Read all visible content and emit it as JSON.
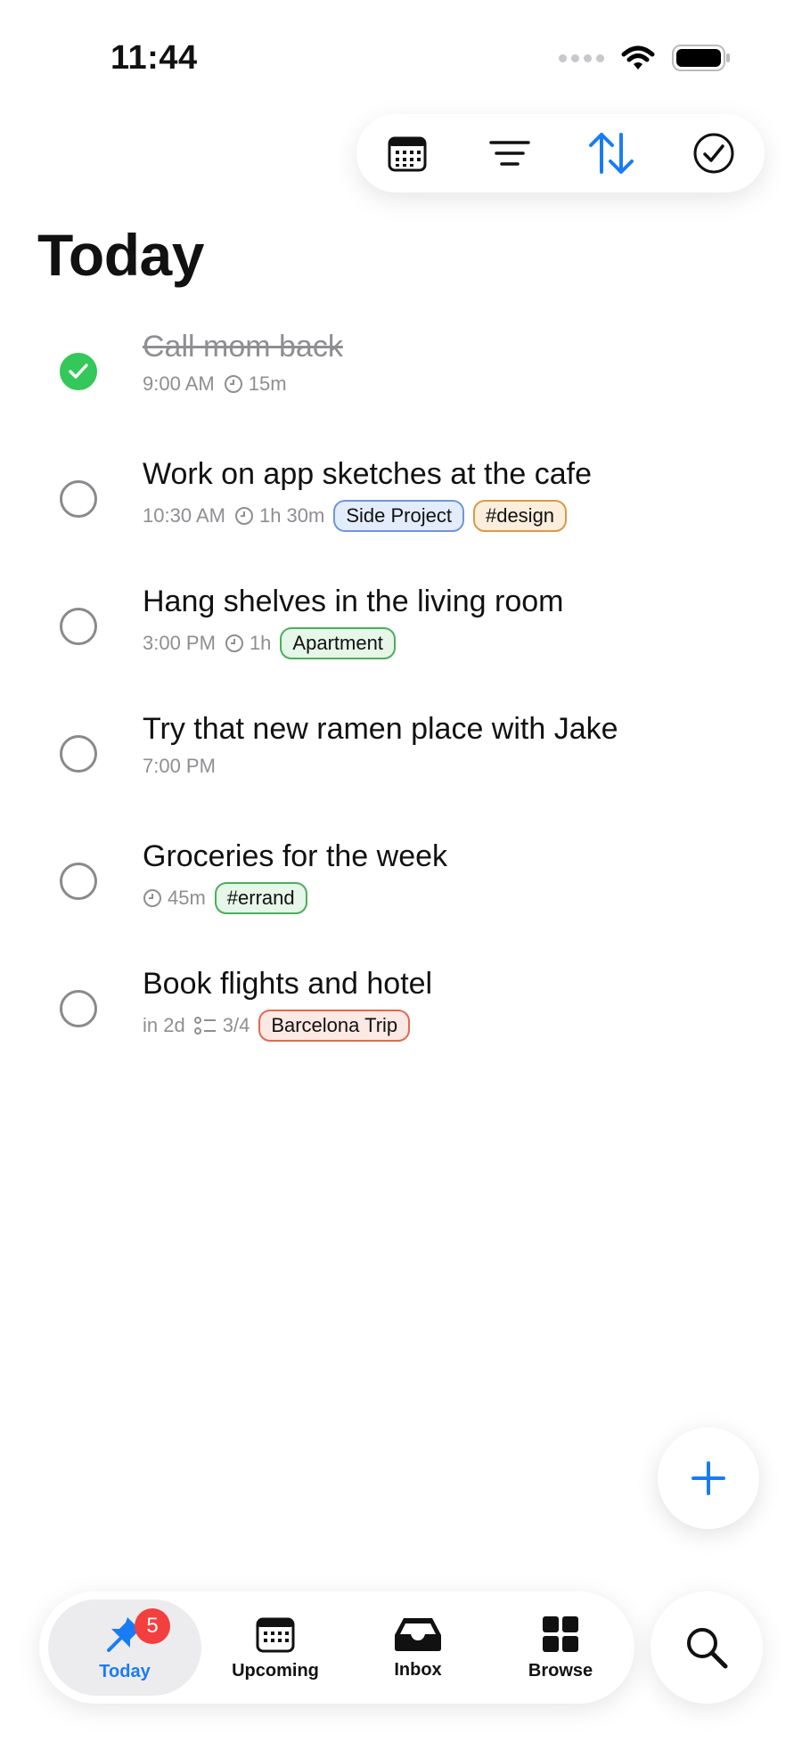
{
  "status_bar": {
    "time": "11:44"
  },
  "toolbar": {
    "icons": [
      "calendar-icon",
      "filter-lines-icon",
      "sort-arrows-icon",
      "checkmark-circle-icon"
    ],
    "accent": "#1a7cf5"
  },
  "page": {
    "title": "Today"
  },
  "tasks": [
    {
      "title": "Call mom back",
      "completed": true,
      "time": "9:00 AM",
      "duration": "15m"
    },
    {
      "title": "Work on app sketches at the cafe",
      "completed": false,
      "time": "10:30 AM",
      "duration": "1h 30m",
      "tags": [
        {
          "label": "Side Project",
          "bg": "#e3ecfb",
          "border": "#6f96d9"
        },
        {
          "label": "#design",
          "bg": "#fbeedd",
          "border": "#d99a45"
        }
      ]
    },
    {
      "title": "Hang shelves in the living room",
      "completed": false,
      "time": "3:00 PM",
      "duration": "1h",
      "tags": [
        {
          "label": "Apartment",
          "bg": "#e6f6e8",
          "border": "#4cae5c"
        }
      ]
    },
    {
      "title": "Try that new ramen place with Jake",
      "completed": false,
      "time": "7:00 PM"
    },
    {
      "title": "Groceries for the week",
      "completed": false,
      "duration": "45m",
      "tags": [
        {
          "label": "#errand",
          "bg": "#e6f6e8",
          "border": "#4cae5c"
        }
      ]
    },
    {
      "title": "Book flights and hotel",
      "completed": false,
      "due": "in 2d",
      "subtasks": "3/4",
      "tags": [
        {
          "label": "Barcelona Trip",
          "bg": "#fde9e4",
          "border": "#e06a4f"
        }
      ]
    }
  ],
  "fab": {
    "icon": "plus-icon"
  },
  "tabbar": {
    "today_badge": "5",
    "items": [
      {
        "label": "Today",
        "icon": "pin-icon",
        "active": true
      },
      {
        "label": "Upcoming",
        "icon": "calendar-icon"
      },
      {
        "label": "Inbox",
        "icon": "inbox-tray-icon"
      },
      {
        "label": "Browse",
        "icon": "grid-icon"
      }
    ]
  },
  "search": {
    "icon": "search-icon"
  }
}
